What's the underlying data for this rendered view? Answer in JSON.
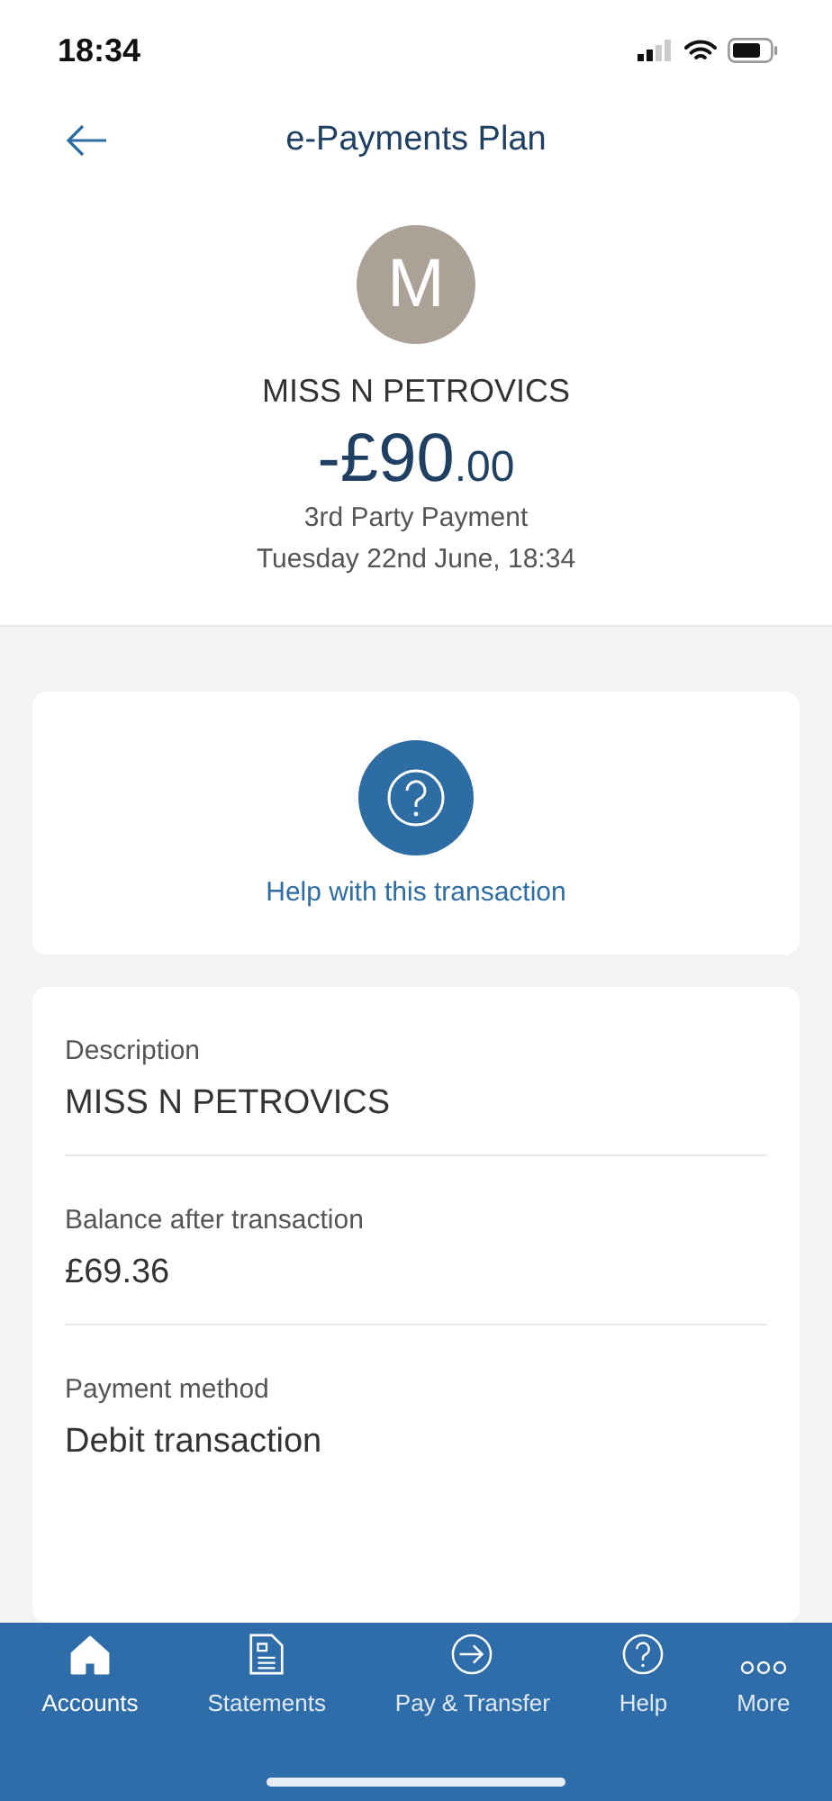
{
  "status_bar": {
    "time": "18:34"
  },
  "header": {
    "title": "e-Payments Plan"
  },
  "payee": {
    "initial": "M",
    "name": "MISS N PETROVICS",
    "amount_main": "-£90",
    "amount_pence": ".00",
    "type": "3rd Party Payment",
    "date": "Tuesday 22nd June, 18:34"
  },
  "help_card": {
    "label": "Help with this transaction"
  },
  "details": [
    {
      "label": "Description",
      "value": "MISS N PETROVICS"
    },
    {
      "label": "Balance after transaction",
      "value": "£69.36"
    },
    {
      "label": "Payment method",
      "value": "Debit transaction"
    }
  ],
  "tab_bar": [
    {
      "kind": "home",
      "label": "Accounts",
      "selected": true
    },
    {
      "kind": "statement",
      "label": "Statements",
      "selected": false
    },
    {
      "kind": "transfer",
      "label": "Pay & Transfer",
      "selected": false
    },
    {
      "kind": "help",
      "label": "Help",
      "selected": false
    },
    {
      "kind": "more",
      "label": "More",
      "selected": false
    }
  ]
}
